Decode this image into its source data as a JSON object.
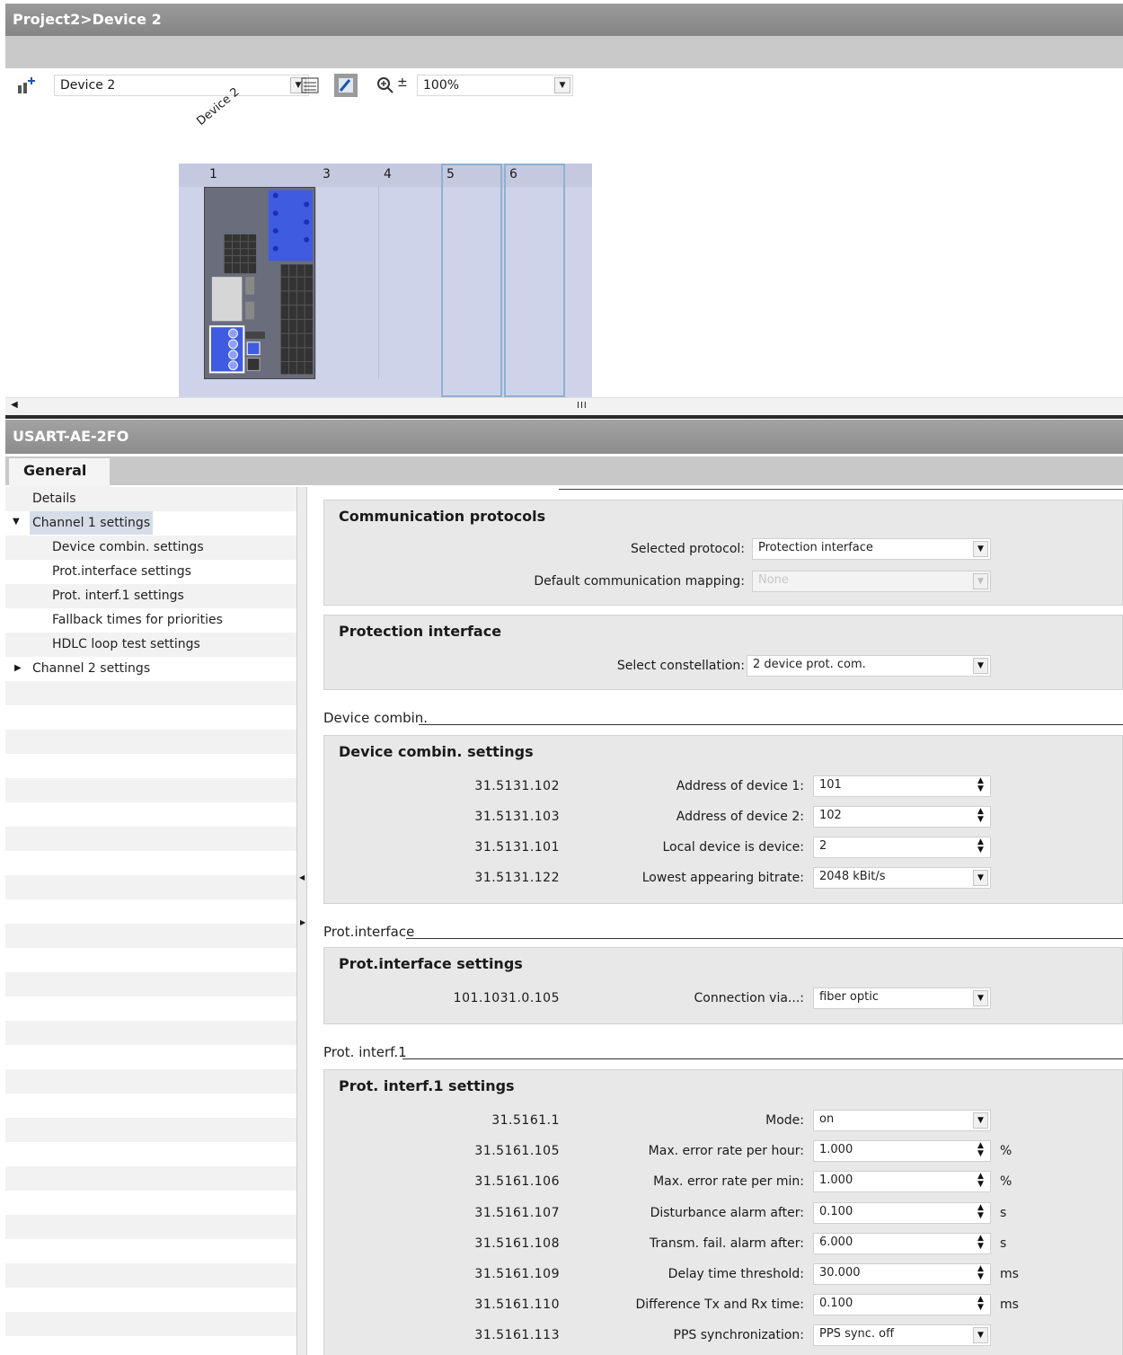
{
  "editor": {
    "title": "Project2>Device 2",
    "device_select": "Device 2",
    "zoom": "100%",
    "device_label": "Device 2",
    "slots": [
      "1",
      "3",
      "4",
      "5",
      "6"
    ]
  },
  "inspector": {
    "title": "USART-AE-2FO",
    "tab": "General",
    "tree": [
      {
        "label": "Details",
        "indent": 0
      },
      {
        "label": "Channel 1 settings",
        "indent": 0,
        "expanded": true,
        "selected": true
      },
      {
        "label": "Device combin. settings",
        "indent": 1
      },
      {
        "label": "Prot.interface settings",
        "indent": 1
      },
      {
        "label": "Prot. interf.1 settings",
        "indent": 1
      },
      {
        "label": "Fallback times for priorities",
        "indent": 1
      },
      {
        "label": "HDLC loop test settings",
        "indent": 1
      },
      {
        "label": "Channel 2 settings",
        "indent": 0,
        "expanded": false
      }
    ]
  },
  "comm": {
    "title": "Communication protocols",
    "selected_protocol_label": "Selected protocol:",
    "selected_protocol": "Protection interface",
    "default_mapping_label": "Default communication mapping:",
    "default_mapping": "None"
  },
  "prot_iface": {
    "title": "Protection interface",
    "constellation_label": "Select constellation:",
    "constellation": "2 device prot. com."
  },
  "device_combin": {
    "section": "Device combin.",
    "title": "Device combin. settings",
    "rows": [
      {
        "param": "31.5131.102",
        "label": "Address of device 1:",
        "value": "101",
        "control": "spin"
      },
      {
        "param": "31.5131.103",
        "label": "Address of device 2:",
        "value": "102",
        "control": "spin"
      },
      {
        "param": "31.5131.101",
        "label": "Local device is device:",
        "value": "2",
        "control": "spin"
      },
      {
        "param": "31.5131.122",
        "label": "Lowest appearing bitrate:",
        "value": "2048 kBit/s",
        "control": "dropdown"
      }
    ]
  },
  "protif_settings": {
    "section": "Prot.interface",
    "title": "Prot.interface settings",
    "rows": [
      {
        "param": "101.1031.0.105",
        "label": "Connection via...:",
        "value": "fiber optic",
        "control": "dropdown"
      }
    ]
  },
  "protif1": {
    "section": "Prot. interf.1",
    "title": "Prot. interf.1 settings",
    "rows": [
      {
        "param": "31.5161.1",
        "label": "Mode:",
        "value": "on",
        "control": "dropdown",
        "unit": ""
      },
      {
        "param": "31.5161.105",
        "label": "Max. error rate per hour:",
        "value": "1.000",
        "control": "spin",
        "unit": "%"
      },
      {
        "param": "31.5161.106",
        "label": "Max. error rate per min:",
        "value": "1.000",
        "control": "spin",
        "unit": "%"
      },
      {
        "param": "31.5161.107",
        "label": "Disturbance alarm after:",
        "value": "0.100",
        "control": "spin",
        "unit": "s"
      },
      {
        "param": "31.5161.108",
        "label": "Transm. fail. alarm after:",
        "value": "6.000",
        "control": "spin",
        "unit": "s"
      },
      {
        "param": "31.5161.109",
        "label": "Delay time threshold:",
        "value": "30.000",
        "control": "spin",
        "unit": "ms"
      },
      {
        "param": "31.5161.110",
        "label": "Difference Tx and Rx time:",
        "value": "0.100",
        "control": "spin",
        "unit": "ms"
      },
      {
        "param": "31.5161.113",
        "label": "PPS synchronization:",
        "value": "PPS sync. off",
        "control": "dropdown",
        "unit": ""
      }
    ]
  }
}
